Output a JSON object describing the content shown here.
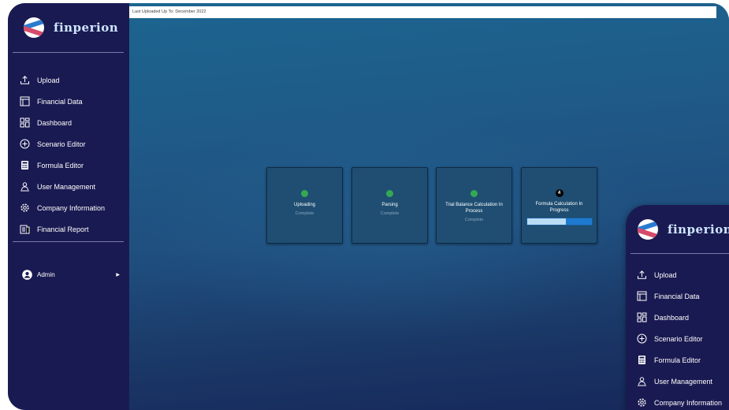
{
  "app": {
    "name": "finperion"
  },
  "topbar": {
    "text": "Last Uploaded Up To: December 2022"
  },
  "sidebar": {
    "items": [
      {
        "label": "Upload",
        "icon": "upload-icon"
      },
      {
        "label": "Financial Data",
        "icon": "table-icon"
      },
      {
        "label": "Dashboard",
        "icon": "dashboard-icon"
      },
      {
        "label": "Scenario Editor",
        "icon": "plus-circle-icon"
      },
      {
        "label": "Formula Editor",
        "icon": "calculator-icon"
      },
      {
        "label": "User Management",
        "icon": "users-icon"
      },
      {
        "label": "Company Information",
        "icon": "gear-icon"
      },
      {
        "label": "Financial Report",
        "icon": "report-icon"
      }
    ],
    "user": {
      "label": "Admin"
    }
  },
  "steps": [
    {
      "title": "Uploading",
      "status": "Complete"
    },
    {
      "title": "Parsing",
      "status": "Complete"
    },
    {
      "title": "Trial Balance Calculation In Process",
      "status": "Complete"
    },
    {
      "title": "Formula Calculation In Progress",
      "badge": "4",
      "progress": 0.6
    }
  ],
  "sidebar_overlay": {
    "items": [
      {
        "label": "Upload"
      },
      {
        "label": "Financial Data"
      },
      {
        "label": "Dashboard"
      },
      {
        "label": "Scenario Editor"
      },
      {
        "label": "Formula Editor"
      },
      {
        "label": "User Management"
      },
      {
        "label": "Company Information"
      }
    ]
  },
  "colors": {
    "sidebar": "#1a1a52",
    "card": "#1f4e72",
    "success": "#34a853",
    "progress_track": "#1e7ad0",
    "progress_fill": "#b9dcf5"
  }
}
